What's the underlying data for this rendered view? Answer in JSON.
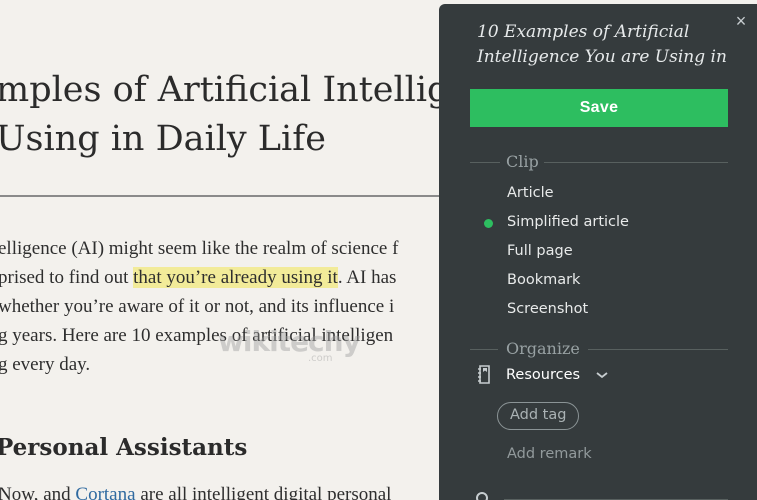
{
  "article": {
    "title_line1": "mples of Artificial Intelligen",
    "title_line2": "Using in Daily Life",
    "body_line1": "elligence (AI) might seem like the realm of science f",
    "body_line2_pre": "prised to find out ",
    "body_line2_highlight": "that you’re already using it",
    "body_line2_post": ". AI has",
    "body_line3": "whether you’re aware of it or not, and its influence i",
    "body_line4": "g years. Here are 10 examples of artificial intelligen",
    "body_line5": "g every day.",
    "section_heading": "Personal Assistants",
    "last_line_pre": "Now, and ",
    "last_line_link": "Cortana",
    "last_line_post": " are all intelligent digital personal",
    "watermark": "wikitechy",
    "watermark_sub": ".com"
  },
  "clipper": {
    "title": "10 Examples of Artificial Intelligence You are Using in",
    "close_icon": "×",
    "save_label": "Save",
    "clip_section": "Clip",
    "clip_options": [
      "Article",
      "Simplified article",
      "Full page",
      "Bookmark",
      "Screenshot"
    ],
    "selected_option": "Simplified article",
    "organize_section": "Organize",
    "notebook": "Resources",
    "add_tag": "Add tag",
    "add_remark": "Add remark"
  },
  "colors": {
    "accent": "#2dbe60",
    "panel_bg": "#353b3d",
    "highlight": "#f2eb99",
    "link": "#2f6aa0"
  },
  "icons": {
    "close": "close-icon",
    "notebook": "notebook-icon",
    "dropdown": "chevron-down-icon",
    "selected": "selected-dot-icon"
  }
}
